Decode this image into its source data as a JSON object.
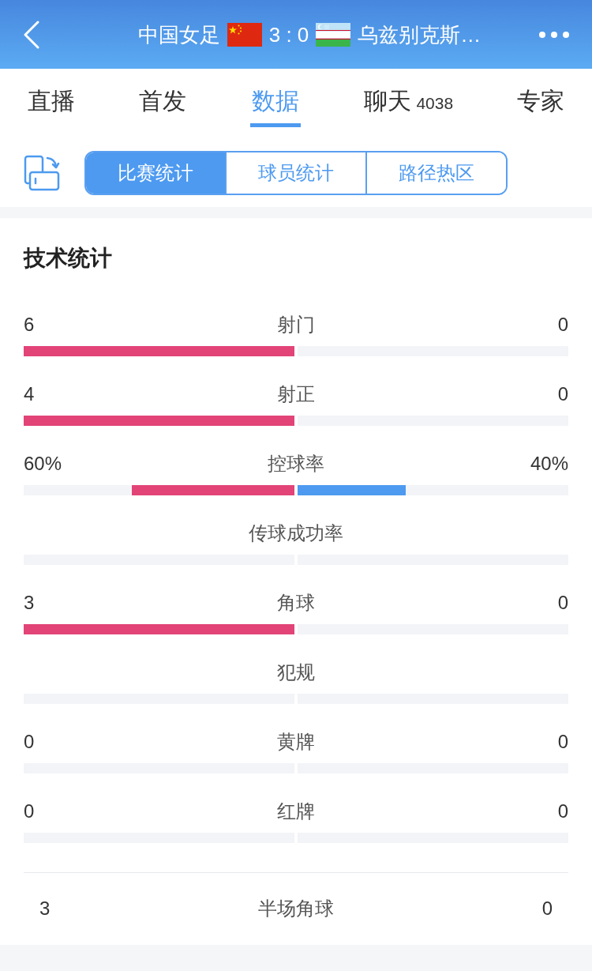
{
  "header": {
    "home_team": "中国女足",
    "score": "3 : 0",
    "away_team": "乌兹别克斯…"
  },
  "tabs": [
    {
      "label": "直播",
      "selected": false
    },
    {
      "label": "首发",
      "selected": false
    },
    {
      "label": "数据",
      "selected": true
    },
    {
      "label": "聊天",
      "count": "4038",
      "selected": false
    },
    {
      "label": "专家",
      "selected": false
    }
  ],
  "segments": [
    {
      "label": "比赛统计",
      "selected": true
    },
    {
      "label": "球员统计",
      "selected": false
    },
    {
      "label": "路径热区",
      "selected": false
    }
  ],
  "section": {
    "title": "技术统计"
  },
  "stats": [
    {
      "label": "射门",
      "home": {
        "value": "6",
        "level": 1
      },
      "away": {
        "value": "0"
      }
    },
    {
      "label": "射正",
      "home": {
        "value": "4",
        "level": 1
      },
      "away": {
        "value": "0"
      }
    },
    {
      "label": "控球率",
      "home": {
        "value": "60%",
        "level": 0.6
      },
      "away": {
        "value": "40%",
        "level": 0.4
      }
    },
    {
      "label": "传球成功率"
    },
    {
      "label": "角球",
      "home": {
        "value": "3",
        "level": 1
      },
      "away": {
        "value": "0"
      }
    },
    {
      "label": "犯规"
    },
    {
      "label": "黄牌",
      "home": {
        "value": "0"
      },
      "away": {
        "value": "0"
      }
    },
    {
      "label": "红牌",
      "home": {
        "value": "0"
      },
      "away": {
        "value": "0"
      }
    }
  ],
  "half_corners": {
    "home": "3",
    "label": "半场角球",
    "away": "0"
  }
}
